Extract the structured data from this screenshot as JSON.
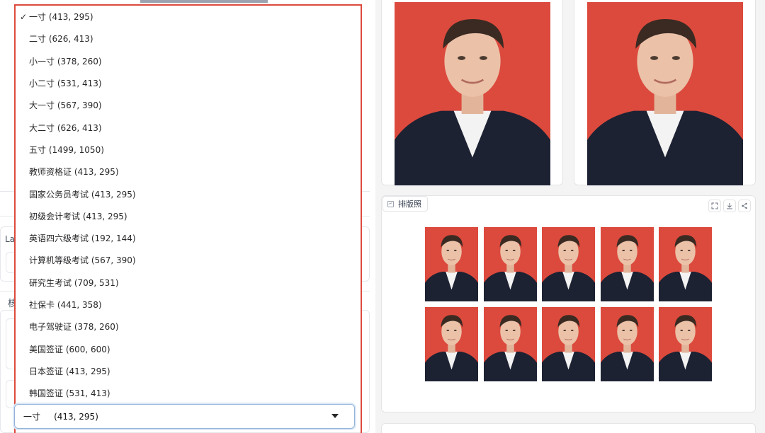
{
  "size_dropdown": {
    "selected_index": 0,
    "check_mark": "✓",
    "options": [
      "一寸 (413, 295)",
      "二寸 (626, 413)",
      "小一寸 (378, 260)",
      "小二寸 (531, 413)",
      "大一寸 (567, 390)",
      "大二寸 (626, 413)",
      "五寸 (1499, 1050)",
      "教师资格证 (413, 295)",
      "国家公务员考试 (413, 295)",
      "初级会计考试 (413, 295)",
      "英语四六级考试 (192, 144)",
      "计算机等级考试 (567, 390)",
      "研究生考试 (709, 531)",
      "社保卡 (441, 358)",
      "电子驾驶证 (378, 260)",
      "美国签证 (600, 600)",
      "日本签证 (413, 295)",
      "韩国签证 (531, 413)"
    ]
  },
  "size_select": {
    "value": "一寸     (413, 295)"
  },
  "background_fragments": {
    "frag1": "La",
    "frag2": "核"
  },
  "layout_panel": {
    "label": "排版照"
  },
  "layout_photos": {
    "rows": 2,
    "cols": 5
  },
  "colors": {
    "accent_red": "#dc4a3d",
    "photo_bg": "#dc4a3d"
  },
  "icons": {
    "fullscreen": "fullscreen-icon",
    "download": "download-icon",
    "share": "share-icon",
    "image": "image-icon"
  }
}
